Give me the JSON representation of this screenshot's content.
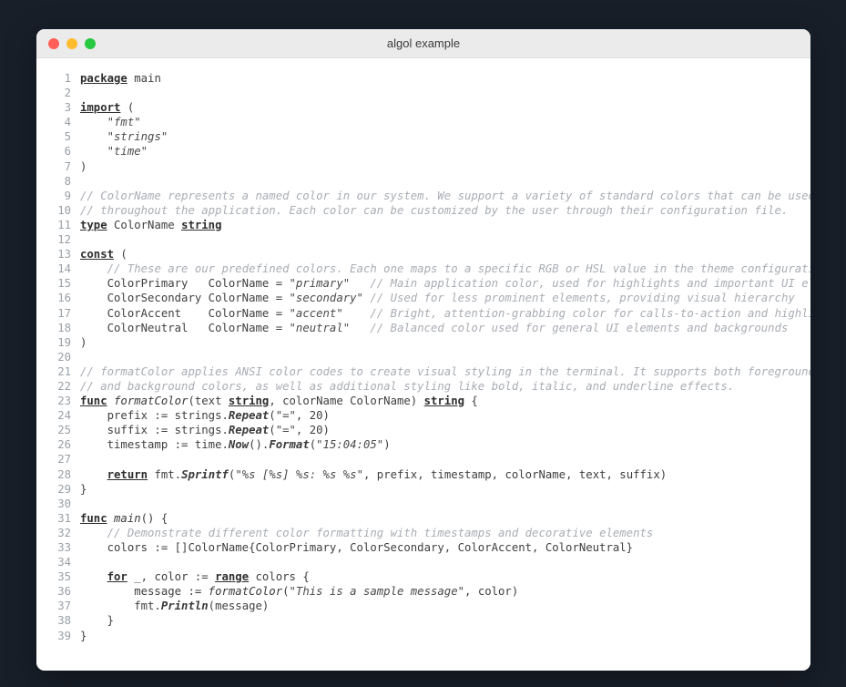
{
  "window": {
    "title": "algol example",
    "controls": [
      {
        "name": "close",
        "color": "#ff5f57"
      },
      {
        "name": "minimize",
        "color": "#febc2e"
      },
      {
        "name": "maximize",
        "color": "#28c840"
      }
    ]
  },
  "theme": {
    "desktop_background": "#181f29",
    "titlebar_background": "#ebebeb",
    "editor_background": "#ffffff",
    "text_color": "#3f3f3f",
    "linenumber_color": "#9aa0a6",
    "comment_color": "#a9adb3"
  },
  "editor": {
    "language": "go",
    "first_line": 1,
    "last_line": 39,
    "line_numbers": [
      "1",
      "2",
      "3",
      "4",
      "5",
      "6",
      "7",
      "8",
      "9",
      "10",
      "11",
      "12",
      "13",
      "14",
      "15",
      "16",
      "17",
      "18",
      "19",
      "20",
      "21",
      "22",
      "23",
      "24",
      "25",
      "26",
      "27",
      "28",
      "29",
      "30",
      "31",
      "32",
      "33",
      "34",
      "35",
      "36",
      "37",
      "38",
      "39"
    ],
    "lines": [
      "package main",
      "",
      "import (",
      "    \"fmt\"",
      "    \"strings\"",
      "    \"time\"",
      ")",
      "",
      "// ColorName represents a named color in our system. We support a variety of standard colors that can be used",
      "// throughout the application. Each color can be customized by the user through their configuration file.",
      "type ColorName string",
      "",
      "const (",
      "    // These are our predefined colors. Each one maps to a specific RGB or HSL value in the theme configuration.",
      "    ColorPrimary   ColorName = \"primary\"   // Main application color, used for highlights and important UI elements",
      "    ColorSecondary ColorName = \"secondary\" // Used for less prominent elements, providing visual hierarchy",
      "    ColorAccent    ColorName = \"accent\"    // Bright, attention-grabbing color for calls-to-action and highlights",
      "    ColorNeutral   ColorName = \"neutral\"   // Balanced color used for general UI elements and backgrounds",
      ")",
      "",
      "// formatColor applies ANSI color codes to create visual styling in the terminal. It supports both foreground",
      "// and background colors, as well as additional styling like bold, italic, and underline effects.",
      "func formatColor(text string, colorName ColorName) string {",
      "    prefix := strings.Repeat(\"=\", 20)",
      "    suffix := strings.Repeat(\"=\", 20)",
      "    timestamp := time.Now().Format(\"15:04:05\")",
      "",
      "    return fmt.Sprintf(\"%s [%s] %s: %s %s\", prefix, timestamp, colorName, text, suffix)",
      "}",
      "",
      "func main() {",
      "    // Demonstrate different color formatting with timestamps and decorative elements",
      "    colors := []ColorName{ColorPrimary, ColorSecondary, ColorAccent, ColorNeutral}",
      "",
      "    for _, color := range colors {",
      "        message := formatColor(\"This is a sample message\", color)",
      "        fmt.Println(message)",
      "    }",
      "}"
    ],
    "tokens": [
      [
        {
          "t": "k",
          "v": "package"
        },
        {
          "t": "p",
          "v": " main"
        }
      ],
      [],
      [
        {
          "t": "k",
          "v": "import"
        },
        {
          "t": "p",
          "v": " ("
        }
      ],
      [
        {
          "t": "p",
          "v": "    "
        },
        {
          "t": "s",
          "v": "\"fmt\""
        }
      ],
      [
        {
          "t": "p",
          "v": "    "
        },
        {
          "t": "s",
          "v": "\"strings\""
        }
      ],
      [
        {
          "t": "p",
          "v": "    "
        },
        {
          "t": "s",
          "v": "\"time\""
        }
      ],
      [
        {
          "t": "p",
          "v": ")"
        }
      ],
      [],
      [
        {
          "t": "c",
          "v": "// ColorName represents a named color in our system. We support a variety of standard colors that can be used"
        }
      ],
      [
        {
          "t": "c",
          "v": "// throughout the application. Each color can be customized by the user through their configuration file."
        }
      ],
      [
        {
          "t": "k",
          "v": "type"
        },
        {
          "t": "p",
          "v": " ColorName "
        },
        {
          "t": "k",
          "v": "string"
        }
      ],
      [],
      [
        {
          "t": "k",
          "v": "const"
        },
        {
          "t": "p",
          "v": " ("
        }
      ],
      [
        {
          "t": "p",
          "v": "    "
        },
        {
          "t": "c",
          "v": "// These are our predefined colors. Each one maps to a specific RGB or HSL value in the theme configuration."
        }
      ],
      [
        {
          "t": "p",
          "v": "    ColorPrimary   ColorName = "
        },
        {
          "t": "s",
          "v": "\"primary\""
        },
        {
          "t": "p",
          "v": "   "
        },
        {
          "t": "c",
          "v": "// Main application color, used for highlights and important UI elements"
        }
      ],
      [
        {
          "t": "p",
          "v": "    ColorSecondary ColorName = "
        },
        {
          "t": "s",
          "v": "\"secondary\""
        },
        {
          "t": "p",
          "v": " "
        },
        {
          "t": "c",
          "v": "// Used for less prominent elements, providing visual hierarchy"
        }
      ],
      [
        {
          "t": "p",
          "v": "    ColorAccent    ColorName = "
        },
        {
          "t": "s",
          "v": "\"accent\""
        },
        {
          "t": "p",
          "v": "    "
        },
        {
          "t": "c",
          "v": "// Bright, attention-grabbing color for calls-to-action and highlights"
        }
      ],
      [
        {
          "t": "p",
          "v": "    ColorNeutral   ColorName = "
        },
        {
          "t": "s",
          "v": "\"neutral\""
        },
        {
          "t": "p",
          "v": "   "
        },
        {
          "t": "c",
          "v": "// Balanced color used for general UI elements and backgrounds"
        }
      ],
      [
        {
          "t": "p",
          "v": ")"
        }
      ],
      [],
      [
        {
          "t": "c",
          "v": "// formatColor applies ANSI color codes to create visual styling in the terminal. It supports both foreground"
        }
      ],
      [
        {
          "t": "c",
          "v": "// and background colors, as well as additional styling like bold, italic, and underline effects."
        }
      ],
      [
        {
          "t": "k",
          "v": "func"
        },
        {
          "t": "p",
          "v": " "
        },
        {
          "t": "fd",
          "v": "formatColor"
        },
        {
          "t": "p",
          "v": "(text "
        },
        {
          "t": "k",
          "v": "string"
        },
        {
          "t": "p",
          "v": ", colorName ColorName) "
        },
        {
          "t": "k",
          "v": "string"
        },
        {
          "t": "p",
          "v": " {"
        }
      ],
      [
        {
          "t": "p",
          "v": "    prefix := strings."
        },
        {
          "t": "fn",
          "v": "Repeat"
        },
        {
          "t": "p",
          "v": "("
        },
        {
          "t": "s",
          "v": "\"=\""
        },
        {
          "t": "p",
          "v": ", 20)"
        }
      ],
      [
        {
          "t": "p",
          "v": "    suffix := strings."
        },
        {
          "t": "fn",
          "v": "Repeat"
        },
        {
          "t": "p",
          "v": "("
        },
        {
          "t": "s",
          "v": "\"=\""
        },
        {
          "t": "p",
          "v": ", 20)"
        }
      ],
      [
        {
          "t": "p",
          "v": "    timestamp := time."
        },
        {
          "t": "fn",
          "v": "Now"
        },
        {
          "t": "p",
          "v": "()."
        },
        {
          "t": "fn",
          "v": "Format"
        },
        {
          "t": "p",
          "v": "("
        },
        {
          "t": "s",
          "v": "\"15:04:05\""
        },
        {
          "t": "p",
          "v": ")"
        }
      ],
      [],
      [
        {
          "t": "p",
          "v": "    "
        },
        {
          "t": "k",
          "v": "return"
        },
        {
          "t": "p",
          "v": " fmt."
        },
        {
          "t": "fn",
          "v": "Sprintf"
        },
        {
          "t": "p",
          "v": "("
        },
        {
          "t": "s",
          "v": "\"%s [%s] %s: %s %s\""
        },
        {
          "t": "p",
          "v": ", prefix, timestamp, colorName, text, suffix)"
        }
      ],
      [
        {
          "t": "p",
          "v": "}"
        }
      ],
      [],
      [
        {
          "t": "k",
          "v": "func"
        },
        {
          "t": "p",
          "v": " "
        },
        {
          "t": "fd",
          "v": "main"
        },
        {
          "t": "p",
          "v": "() {"
        }
      ],
      [
        {
          "t": "p",
          "v": "    "
        },
        {
          "t": "c",
          "v": "// Demonstrate different color formatting with timestamps and decorative elements"
        }
      ],
      [
        {
          "t": "p",
          "v": "    colors := []ColorName{ColorPrimary, ColorSecondary, ColorAccent, ColorNeutral}"
        }
      ],
      [],
      [
        {
          "t": "p",
          "v": "    "
        },
        {
          "t": "k",
          "v": "for"
        },
        {
          "t": "p",
          "v": " _, color := "
        },
        {
          "t": "k",
          "v": "range"
        },
        {
          "t": "p",
          "v": " colors {"
        }
      ],
      [
        {
          "t": "p",
          "v": "        message := "
        },
        {
          "t": "fd",
          "v": "formatColor"
        },
        {
          "t": "p",
          "v": "("
        },
        {
          "t": "s",
          "v": "\"This is a sample message\""
        },
        {
          "t": "p",
          "v": ", color)"
        }
      ],
      [
        {
          "t": "p",
          "v": "        fmt."
        },
        {
          "t": "fn",
          "v": "Println"
        },
        {
          "t": "p",
          "v": "(message)"
        }
      ],
      [
        {
          "t": "p",
          "v": "    }"
        }
      ],
      [
        {
          "t": "p",
          "v": "}"
        }
      ]
    ]
  }
}
